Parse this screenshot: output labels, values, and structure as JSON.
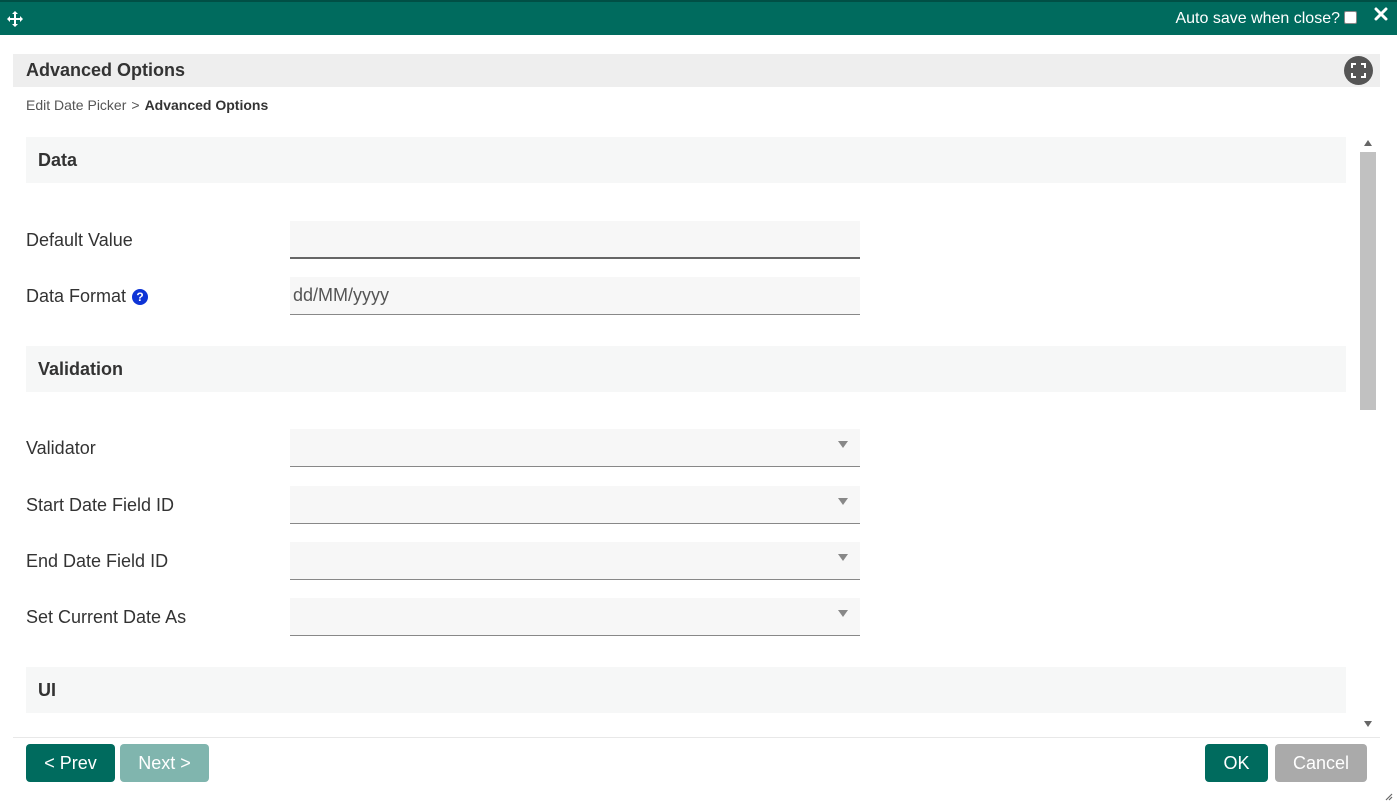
{
  "topbar": {
    "move_icon": "move-arrows-icon",
    "autosave_label": "Auto save when close?",
    "autosave_checked": false,
    "close_icon": "close-icon"
  },
  "dialog": {
    "title": "Advanced Options",
    "fullscreen_icon": "fullscreen-icon"
  },
  "breadcrumb": {
    "parent": "Edit Date Picker",
    "separator": ">",
    "current": "Advanced Options"
  },
  "sections": {
    "data": {
      "title": "Data",
      "default_value": {
        "label": "Default Value",
        "value": ""
      },
      "data_format": {
        "label": "Data Format",
        "value": "dd/MM/yyyy",
        "help_icon": "question-circle-icon",
        "help_glyph": "?"
      }
    },
    "validation": {
      "title": "Validation",
      "validator": {
        "label": "Validator",
        "value": ""
      },
      "start_date_field_id": {
        "label": "Start Date Field ID",
        "value": ""
      },
      "end_date_field_id": {
        "label": "End Date Field ID",
        "value": ""
      },
      "set_current_date_as": {
        "label": "Set Current Date As",
        "value": ""
      }
    },
    "ui": {
      "title": "UI"
    }
  },
  "footer": {
    "prev_label": "< Prev",
    "next_label": "Next >",
    "ok_label": "OK",
    "cancel_label": "Cancel"
  },
  "colors": {
    "primary": "#006b5e",
    "primary_disabled": "#80b5ae",
    "cancel": "#aaaaaa",
    "help": "#0e34d6"
  }
}
